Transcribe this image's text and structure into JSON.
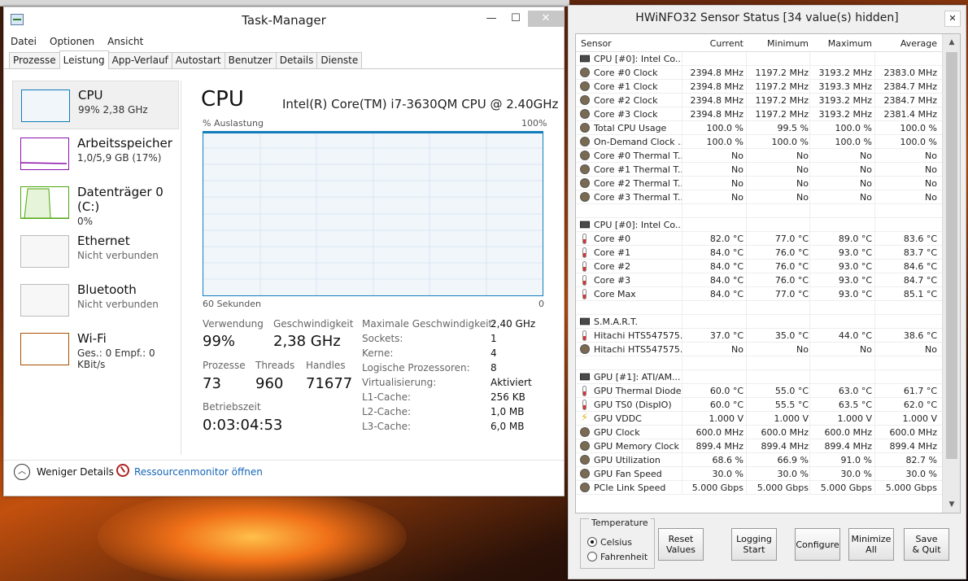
{
  "taskmanager": {
    "title": "Task-Manager",
    "menu": [
      "Datei",
      "Optionen",
      "Ansicht"
    ],
    "tabs": [
      "Prozesse",
      "Leistung",
      "App-Verlauf",
      "Autostart",
      "Benutzer",
      "Details",
      "Dienste"
    ],
    "active_tab": "Leistung",
    "sidebar": [
      {
        "name": "CPU",
        "sub": "99% 2,38 GHz"
      },
      {
        "name": "Arbeitsspeicher",
        "sub": "1,0/5,9 GB (17%)"
      },
      {
        "name": "Datenträger 0 (C:)",
        "sub": "0%"
      },
      {
        "name": "Ethernet",
        "sub": "Nicht verbunden"
      },
      {
        "name": "Bluetooth",
        "sub": "Nicht verbunden"
      },
      {
        "name": "Wi-Fi",
        "sub": "Ges.: 0 Empf.: 0 KBit/s"
      }
    ],
    "main": {
      "title": "CPU",
      "model": "Intel(R) Core(TM) i7-3630QM CPU @ 2.40GHz",
      "axis_top_left": "% Auslastung",
      "axis_top_right": "100%",
      "axis_bottom_left": "60 Sekunden",
      "axis_bottom_right": "0",
      "usage_level": 1.0,
      "stats": {
        "verwendung_label": "Verwendung",
        "verwendung": "99%",
        "geschw_label": "Geschwindigkeit",
        "geschw": "2,38 GHz",
        "prozesse_label": "Prozesse",
        "prozesse": "73",
        "threads_label": "Threads",
        "threads": "960",
        "handles_label": "Handles",
        "handles": "71677",
        "betrieb_label": "Betriebszeit",
        "betrieb": "0:03:04:53"
      },
      "specs": [
        {
          "k": "Maximale Geschwindigkeit:",
          "v": "2,40 GHz"
        },
        {
          "k": "Sockets:",
          "v": "1"
        },
        {
          "k": "Kerne:",
          "v": "4"
        },
        {
          "k": "Logische Prozessoren:",
          "v": "8"
        },
        {
          "k": "Virtualisierung:",
          "v": "Aktiviert"
        },
        {
          "k": "L1-Cache:",
          "v": "256 KB"
        },
        {
          "k": "L2-Cache:",
          "v": "1,0 MB"
        },
        {
          "k": "L3-Cache:",
          "v": "6,0 MB"
        }
      ]
    },
    "footer": {
      "fewer": "Weniger Details",
      "resmon": "Ressourcenmonitor öffnen"
    },
    "accent": "#117dbb"
  },
  "hwinfo": {
    "title": "HWiNFO32 Sensor Status [34 value(s) hidden]",
    "columns": [
      "Sensor",
      "Current",
      "Minimum",
      "Maximum",
      "Average"
    ],
    "rows": [
      {
        "icon": "chip",
        "name": "CPU [#0]: Intel Co...",
        "cur": "",
        "min": "",
        "max": "",
        "avg": ""
      },
      {
        "icon": "gauge",
        "name": "Core #0 Clock",
        "cur": "2394.8 MHz",
        "min": "1197.2 MHz",
        "max": "3193.2 MHz",
        "avg": "2383.0 MHz"
      },
      {
        "icon": "gauge",
        "name": "Core #1 Clock",
        "cur": "2394.8 MHz",
        "min": "1197.2 MHz",
        "max": "3193.3 MHz",
        "avg": "2384.7 MHz"
      },
      {
        "icon": "gauge",
        "name": "Core #2 Clock",
        "cur": "2394.8 MHz",
        "min": "1197.2 MHz",
        "max": "3193.2 MHz",
        "avg": "2384.7 MHz"
      },
      {
        "icon": "gauge",
        "name": "Core #3 Clock",
        "cur": "2394.8 MHz",
        "min": "1197.2 MHz",
        "max": "3193.2 MHz",
        "avg": "2381.4 MHz"
      },
      {
        "icon": "gauge",
        "name": "Total CPU Usage",
        "cur": "100.0 %",
        "min": "99.5 %",
        "max": "100.0 %",
        "avg": "100.0 %"
      },
      {
        "icon": "gauge",
        "name": "On-Demand Clock ...",
        "cur": "100.0 %",
        "min": "100.0 %",
        "max": "100.0 %",
        "avg": "100.0 %"
      },
      {
        "icon": "gauge",
        "name": "Core #0 Thermal T...",
        "cur": "No",
        "min": "No",
        "max": "No",
        "avg": "No"
      },
      {
        "icon": "gauge",
        "name": "Core #1 Thermal T...",
        "cur": "No",
        "min": "No",
        "max": "No",
        "avg": "No"
      },
      {
        "icon": "gauge",
        "name": "Core #2 Thermal T...",
        "cur": "No",
        "min": "No",
        "max": "No",
        "avg": "No"
      },
      {
        "icon": "gauge",
        "name": "Core #3 Thermal T...",
        "cur": "No",
        "min": "No",
        "max": "No",
        "avg": "No"
      },
      {
        "icon": "",
        "name": "",
        "cur": "",
        "min": "",
        "max": "",
        "avg": ""
      },
      {
        "icon": "chip",
        "name": "CPU [#0]: Intel Co...",
        "cur": "",
        "min": "",
        "max": "",
        "avg": ""
      },
      {
        "icon": "therm",
        "name": "Core #0",
        "cur": "82.0 °C",
        "min": "77.0 °C",
        "max": "89.0 °C",
        "avg": "83.6 °C"
      },
      {
        "icon": "therm",
        "name": "Core #1",
        "cur": "84.0 °C",
        "min": "76.0 °C",
        "max": "93.0 °C",
        "avg": "83.7 °C"
      },
      {
        "icon": "therm",
        "name": "Core #2",
        "cur": "84.0 °C",
        "min": "76.0 °C",
        "max": "93.0 °C",
        "avg": "84.6 °C"
      },
      {
        "icon": "therm",
        "name": "Core #3",
        "cur": "84.0 °C",
        "min": "76.0 °C",
        "max": "93.0 °C",
        "avg": "84.7 °C"
      },
      {
        "icon": "therm",
        "name": "Core Max",
        "cur": "84.0 °C",
        "min": "77.0 °C",
        "max": "93.0 °C",
        "avg": "85.1 °C"
      },
      {
        "icon": "",
        "name": "",
        "cur": "",
        "min": "",
        "max": "",
        "avg": ""
      },
      {
        "icon": "chip",
        "name": "S.M.A.R.T.",
        "cur": "",
        "min": "",
        "max": "",
        "avg": ""
      },
      {
        "icon": "therm",
        "name": "Hitachi HTS547575...",
        "cur": "37.0 °C",
        "min": "35.0 °C",
        "max": "44.0 °C",
        "avg": "38.6 °C"
      },
      {
        "icon": "gauge",
        "name": "Hitachi HTS547575...",
        "cur": "No",
        "min": "No",
        "max": "No",
        "avg": "No"
      },
      {
        "icon": "",
        "name": "",
        "cur": "",
        "min": "",
        "max": "",
        "avg": ""
      },
      {
        "icon": "chip",
        "name": "GPU [#1]: ATI/AM...",
        "cur": "",
        "min": "",
        "max": "",
        "avg": ""
      },
      {
        "icon": "therm",
        "name": "GPU Thermal Diode",
        "cur": "60.0 °C",
        "min": "55.0 °C",
        "max": "63.0 °C",
        "avg": "61.7 °C"
      },
      {
        "icon": "therm",
        "name": "GPU TS0 (DispIO)",
        "cur": "60.0 °C",
        "min": "55.5 °C",
        "max": "63.5 °C",
        "avg": "62.0 °C"
      },
      {
        "icon": "volt",
        "name": "GPU VDDC",
        "cur": "1.000 V",
        "min": "1.000 V",
        "max": "1.000 V",
        "avg": "1.000 V"
      },
      {
        "icon": "gauge",
        "name": "GPU Clock",
        "cur": "600.0 MHz",
        "min": "600.0 MHz",
        "max": "600.0 MHz",
        "avg": "600.0 MHz"
      },
      {
        "icon": "gauge",
        "name": "GPU Memory Clock",
        "cur": "899.4 MHz",
        "min": "899.4 MHz",
        "max": "899.4 MHz",
        "avg": "899.4 MHz"
      },
      {
        "icon": "gauge",
        "name": "GPU Utilization",
        "cur": "68.6 %",
        "min": "66.9 %",
        "max": "91.0 %",
        "avg": "82.7 %"
      },
      {
        "icon": "gauge",
        "name": "GPU Fan Speed",
        "cur": "30.0 %",
        "min": "30.0 %",
        "max": "30.0 %",
        "avg": "30.0 %"
      },
      {
        "icon": "gauge",
        "name": "PCIe Link Speed",
        "cur": "5.000 Gbps",
        "min": "5.000 Gbps",
        "max": "5.000 Gbps",
        "avg": "5.000 Gbps"
      }
    ],
    "temperature": {
      "title": "Temperature",
      "celsius": "Celsius",
      "fahrenheit": "Fahrenheit",
      "selected": "celsius"
    },
    "buttons": {
      "reset": "Reset\nValues",
      "logging": "Logging\nStart",
      "configure": "Configure",
      "minimize": "Minimize\nAll",
      "save": "Save\n& Quit"
    }
  }
}
